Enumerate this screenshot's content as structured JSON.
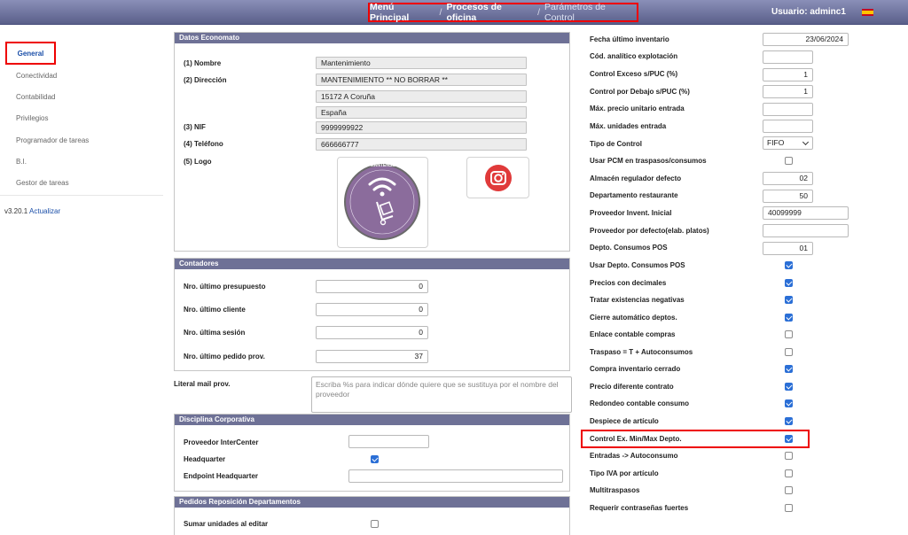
{
  "header": {
    "breadcrumb": [
      "Menú Principal",
      "Procesos de oficina",
      "Parámetros de Control"
    ],
    "separator": "/",
    "user": "Usuario: adminc1"
  },
  "sidebar": {
    "items": [
      "General",
      "Conectividad",
      "Contabilidad",
      "Privilegios",
      "Programador de tareas",
      "B.I.",
      "Gestor de tareas"
    ],
    "version": "v3.20.1",
    "update_link": "Actualizar"
  },
  "datos": {
    "title": "Datos Economato",
    "nombre_label": "(1) Nombre",
    "nombre": "Mantenimiento",
    "direccion_label": "(2) Dirección",
    "direccion1": "MANTENIMIENTO ** NO BORRAR **",
    "direccion2": "15172 A Coruña",
    "direccion3": "España",
    "nif_label": "(3) NIF",
    "nif": "9999999922",
    "telefono_label": "(4) Teléfono",
    "telefono": "666666777",
    "logo_label": "(5) Logo",
    "logo_text": "MANTENSE"
  },
  "contadores": {
    "title": "Contadores",
    "rows": [
      {
        "label": "Nro. último presupuesto",
        "value": "0"
      },
      {
        "label": "Nro. último cliente",
        "value": "0"
      },
      {
        "label": "Nro. última sesión",
        "value": "0"
      },
      {
        "label": "Nro. último pedido prov.",
        "value": "37"
      }
    ]
  },
  "literal": {
    "label": "Literal mail prov.",
    "placeholder": "Escriba %s para indicar dónde quiere que se sustituya por el nombre del proveedor"
  },
  "disciplina": {
    "title": "Disciplina Corporativa",
    "proveedor_label": "Proveedor InterCenter",
    "proveedor": "",
    "hq_label": "Headquarter",
    "hq_checked": true,
    "endpoint_label": "Endpoint Headquarter",
    "endpoint": ""
  },
  "pedidos": {
    "title": "Pedidos Reposición Departamentos",
    "sumar_label": "Sumar unidades al editar",
    "sumar_checked": false
  },
  "params": {
    "fecha_label": "Fecha último inventario",
    "fecha": "23/06/2024",
    "cod_label": "Cód. analítico explotación",
    "cod": "",
    "exceso_label": "Control Exceso s/PUC (%)",
    "exceso": "1",
    "debajo_label": "Control por Debajo s/PUC (%)",
    "debajo": "1",
    "maxprecio_label": "Máx. precio unitario entrada",
    "maxprecio": "",
    "maxunid_label": "Máx. unidades entrada",
    "maxunid": "",
    "tipo_label": "Tipo de Control",
    "tipo": "FIFO",
    "pcm_label": "Usar PCM en traspasos/consumos",
    "almacen_label": "Almacén regulador defecto",
    "almacen": "02",
    "depto_label": "Departamento restaurante",
    "depto": "50",
    "provinv_label": "Proveedor Invent. Inicial",
    "provinv": "40099999",
    "provdef_label": "Proveedor por defecto(elab. platos)",
    "provdef": "",
    "deptopos_label": "Depto. Consumos POS",
    "deptopos": "01",
    "checks": [
      {
        "label": "Usar Depto. Consumos POS",
        "checked": true
      },
      {
        "label": "Precios con decimales",
        "checked": true
      },
      {
        "label": "Tratar existencias negativas",
        "checked": true
      },
      {
        "label": "Cierre automático deptos.",
        "checked": true
      },
      {
        "label": "Enlace contable compras",
        "checked": false
      },
      {
        "label": "Traspaso = T + Autoconsumos",
        "checked": false
      },
      {
        "label": "Compra inventario cerrado",
        "checked": true
      },
      {
        "label": "Precio diferente contrato",
        "checked": true
      },
      {
        "label": "Redondeo contable consumo",
        "checked": true
      },
      {
        "label": "Despiece de artículo",
        "checked": true
      },
      {
        "label": "Control Ex. Min/Max Depto.",
        "checked": true
      },
      {
        "label": "Entradas -> Autoconsumo",
        "checked": false
      },
      {
        "label": "Tipo IVA por artículo",
        "checked": false
      },
      {
        "label": "Multitraspasos",
        "checked": false
      },
      {
        "label": "Requerir contraseñas fuertes",
        "checked": false
      }
    ]
  },
  "colors": {
    "accent": "#2b6fd6",
    "header": "#6e7196",
    "highlight": "#e00000"
  },
  "icons": {
    "logo1": "wifi-hand-truck-icon",
    "logo2": "instagram-icon"
  }
}
